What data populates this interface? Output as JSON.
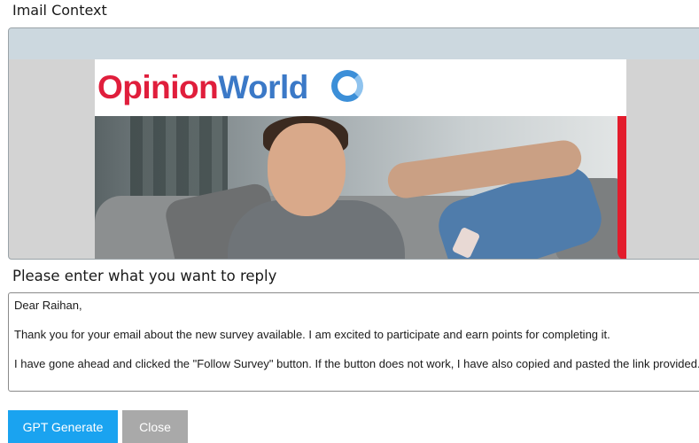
{
  "email_section": {
    "title": "Imail Context",
    "logo": {
      "part1": "Opinion",
      "part2": "World"
    }
  },
  "reply_section": {
    "title": "Please enter what you want to reply",
    "text": "Dear Raihan,\n\nThank you for your email about the new survey available. I am excited to participate and earn points for completing it.\n\nI have gone ahead and clicked the \"Follow Survey\" button. If the button does not work, I have also copied and pasted the link provided."
  },
  "buttons": {
    "generate": "GPT Generate",
    "close": "Close"
  },
  "colors": {
    "primary_button": "#1aa3f0",
    "secondary_button": "#a9a9a9",
    "brand_red": "#e01e3c",
    "brand_blue": "#3b79c7"
  }
}
